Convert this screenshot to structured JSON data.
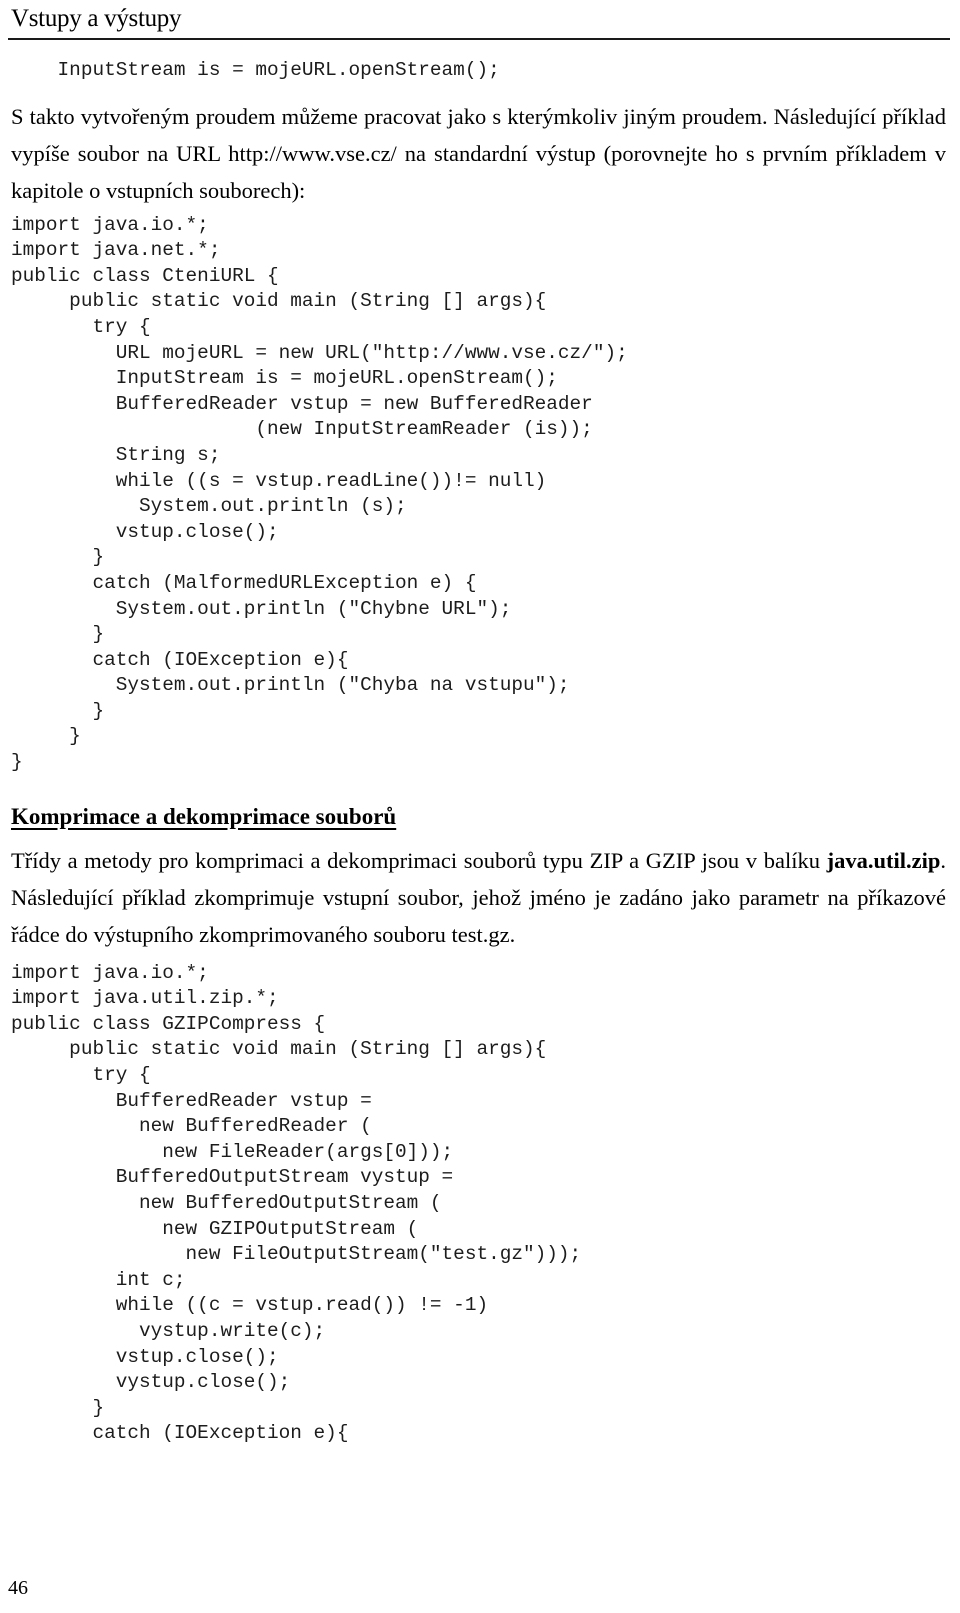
{
  "document": {
    "running_header": "Vstupy a výstupy",
    "page_number": "46"
  },
  "intro_code_line": "    InputStream is = mojeURL.openStream();",
  "paragraphs": {
    "p1_part1": "S takto vytvořeným proudem můžeme pracovat jako s kterýmkoliv jiným proudem. Následující příklad vypíše soubor na URL http://www.vse.cz/ na standardní výstup (porovnejte ho s prvním příkladem v kapitole o vstupních souborech):",
    "p2_part1": "Třídy a metody pro komprimaci a dekomprimaci souborů typu ZIP a GZIP jsou v balíku ",
    "p2_bold": "java.util.zip",
    "p2_part2": ". Následující příklad zkomprimuje vstupní soubor, jehož jméno je zadáno jako parametr na příkazové řádce do výstupního zkomprimovaného souboru test.gz."
  },
  "section_heading": "Komprimace a dekomprimace souborů",
  "code_block_1": {
    "language": "java",
    "lines": [
      "import java.io.*;",
      "import java.net.*;",
      "public class CteniURL {",
      "     public static void main (String [] args){",
      "       try {",
      "         URL mojeURL = new URL(\"http://www.vse.cz/\");",
      "         InputStream is = mojeURL.openStream();",
      "         BufferedReader vstup = new BufferedReader",
      "                     (new InputStreamReader (is));",
      "         String s;",
      "         while ((s = vstup.readLine())!= null)",
      "           System.out.println (s);",
      "         vstup.close();",
      "       }",
      "       catch (MalformedURLException e) {",
      "         System.out.println (\"Chybne URL\");",
      "       }",
      "       catch (IOException e){",
      "         System.out.println (\"Chyba na vstupu\");",
      "       }",
      "     }",
      "}"
    ]
  },
  "code_block_2": {
    "language": "java",
    "lines": [
      "import java.io.*;",
      "import java.util.zip.*;",
      "public class GZIPCompress {",
      "     public static void main (String [] args){",
      "       try {",
      "         BufferedReader vstup =",
      "           new BufferedReader (",
      "             new FileReader(args[0]));",
      "         BufferedOutputStream vystup =",
      "           new BufferedOutputStream (",
      "             new GZIPOutputStream (",
      "               new FileOutputStream(\"test.gz\")));",
      "         int c;",
      "         while ((c = vstup.read()) != -1)",
      "           vystup.write(c);",
      "         vstup.close();",
      "         vystup.close();",
      "       }",
      "       catch (IOException e){"
    ]
  }
}
